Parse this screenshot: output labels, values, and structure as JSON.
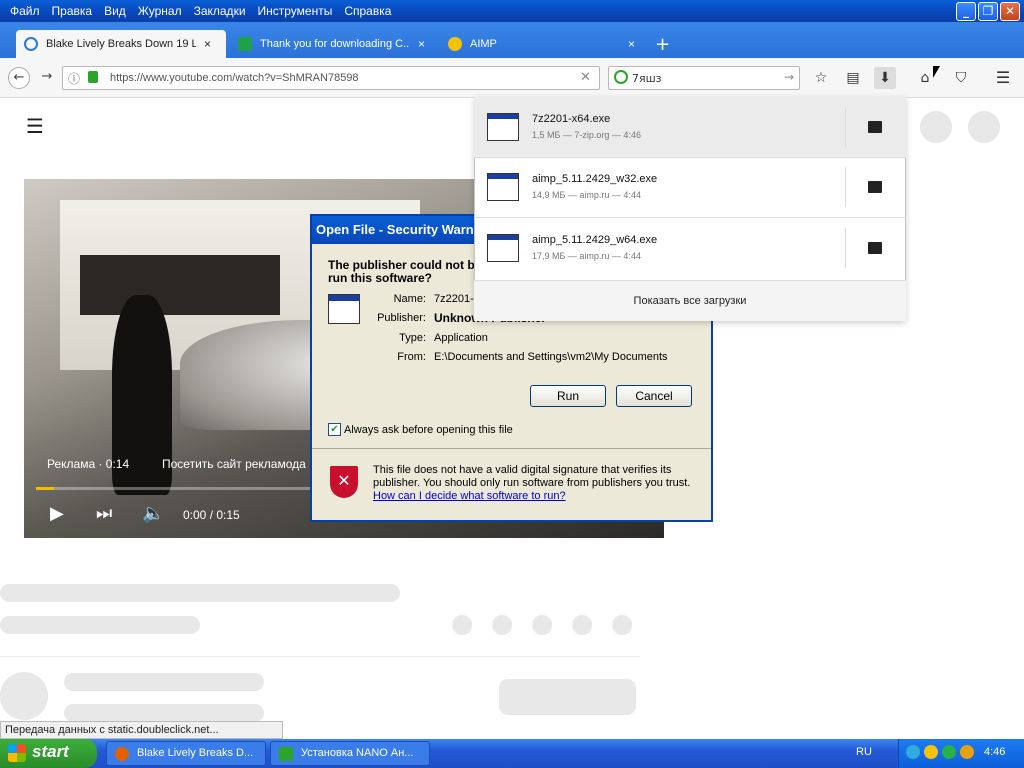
{
  "menu": [
    "Файл",
    "Правка",
    "Вид",
    "Журнал",
    "Закладки",
    "Инструменты",
    "Справка"
  ],
  "tabs": [
    {
      "label": "Blake Lively Breaks Down 19 L...",
      "close": "×"
    },
    {
      "label": "Thank you for downloading C...",
      "close": "×"
    },
    {
      "label": "AIMP",
      "close": "×"
    }
  ],
  "new_tab": "+",
  "url": "https://www.youtube.com/watch?v=ShMRAN78598",
  "search": "7яшз",
  "video": {
    "ad_label": "Реклама · 0:14",
    "visit_label": "Посетить сайт рекламода",
    "time": "0:00 / 0:15",
    "progress": 0.03
  },
  "dialog": {
    "title": "Open File - Security Warning",
    "heading": "The publisher could not be verified. Are you sure you want to run this software?",
    "name_label": "Name:",
    "name": "7z2201-x64.exe",
    "publisher_label": "Publisher:",
    "publisher": "Unknown Publisher",
    "type_label": "Type:",
    "type": "Application",
    "from_label": "From:",
    "from": "E:\\Documents and Settings\\vm2\\My Documents",
    "run": "Run",
    "cancel": "Cancel",
    "checkbox": "Always ask before opening this file",
    "checked": true,
    "warning": "This file does not have a valid digital signature that verifies its publisher.  You should only run software from publishers you trust.",
    "link": "How can I decide what software to run?"
  },
  "downloads": [
    {
      "name": "7z2201-x64.exe",
      "meta": "1,5 МБ — 7-zip.org — 4:46"
    },
    {
      "name": "aimp_5.11.2429_w32.exe",
      "meta": "14,9 МБ — aimp.ru — 4:44"
    },
    {
      "name": "aimp_5.11.2429_w64.exe",
      "meta": "17,9 МБ — aimp.ru — 4:44"
    }
  ],
  "show_all": "Показать все загрузки",
  "status": "Передача данных с static.doubleclick.net...",
  "taskbar": {
    "start": "start",
    "items": [
      "Blake Lively Breaks D...",
      "Установка NANO Ан..."
    ],
    "lang": "RU",
    "clock": "4:46"
  }
}
